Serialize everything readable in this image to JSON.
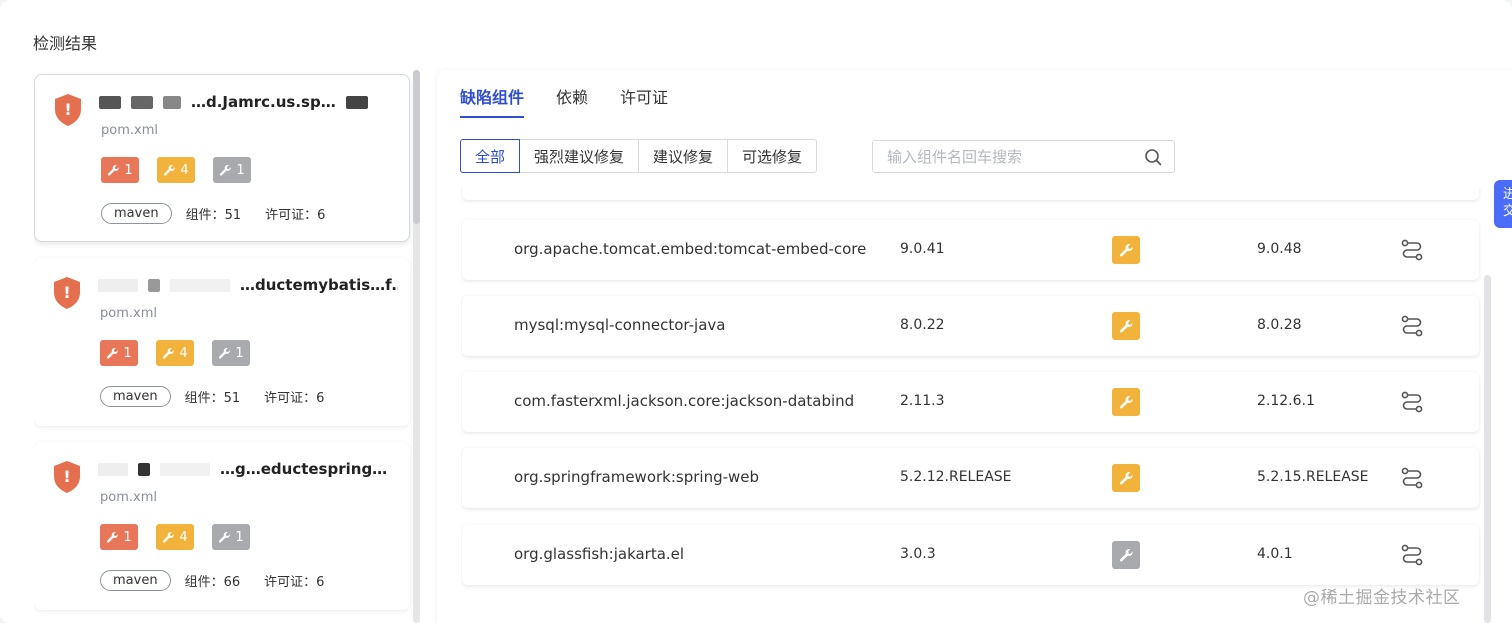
{
  "page": {
    "title": "检测结果"
  },
  "projects": [
    {
      "name": "…d.Jamrc.us.sp…",
      "file": "pom.xml",
      "counts": [
        "1",
        "4",
        "1"
      ],
      "type": "maven",
      "components_label": "组件：51",
      "license_label": "许可证：6"
    },
    {
      "name": "…ductemybatis…f…",
      "file": "pom.xml",
      "counts": [
        "1",
        "4",
        "1"
      ],
      "type": "maven",
      "components_label": "组件：51",
      "license_label": "许可证：6"
    },
    {
      "name": "…g…eductespring…",
      "file": "pom.xml",
      "counts": [
        "1",
        "4",
        "1"
      ],
      "type": "maven",
      "components_label": "组件：66",
      "license_label": "许可证：6"
    }
  ],
  "tabs": [
    {
      "label": "缺陷组件",
      "active": true
    },
    {
      "label": "依赖",
      "active": false
    },
    {
      "label": "许可证",
      "active": false
    }
  ],
  "filters": [
    {
      "label": "全部",
      "active": true
    },
    {
      "label": "强烈建议修复",
      "active": false
    },
    {
      "label": "建议修复",
      "active": false
    },
    {
      "label": "可选修复",
      "active": false
    }
  ],
  "search": {
    "placeholder": "输入组件名回车搜索",
    "value": "",
    "icon": "search-icon"
  },
  "components": [
    {
      "name": "org.apache.tomcat.embed:tomcat-embed-core",
      "version": "9.0.41",
      "severity": "orange",
      "recommended": "9.0.48"
    },
    {
      "name": "mysql:mysql-connector-java",
      "version": "8.0.22",
      "severity": "orange",
      "recommended": "8.0.28"
    },
    {
      "name": "com.fasterxml.jackson.core:jackson-databind",
      "version": "2.11.3",
      "severity": "orange",
      "recommended": "2.12.6.1"
    },
    {
      "name": "org.springframework:spring-web",
      "version": "5.2.12.RELEASE",
      "severity": "orange",
      "recommended": "5.2.15.RELEASE"
    },
    {
      "name": "org.glassfish:jakarta.el",
      "version": "3.0.3",
      "severity": "gray",
      "recommended": "4.0.1"
    }
  ],
  "colors": {
    "accent": "#2f4fcf",
    "red": "#e8775a",
    "orange": "#f2b33d",
    "gray": "#a9aaad",
    "shield": "#e5704f"
  },
  "side_button": {
    "label": "进交"
  },
  "watermark": "@稀土掘金技术社区"
}
